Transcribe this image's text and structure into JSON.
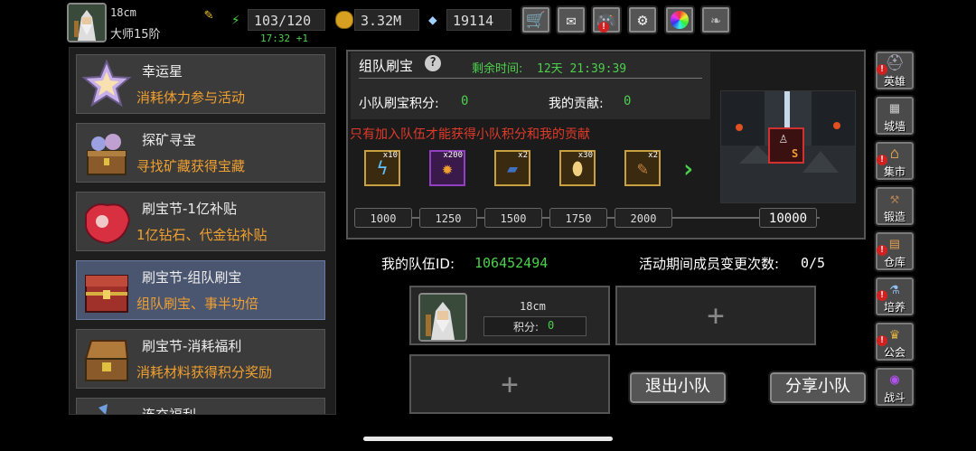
{
  "player": {
    "name": "18cm",
    "rank": "大师15阶",
    "energy": "103/120",
    "energy_timer": "17:32 +1",
    "gold": "3.32M",
    "gems": "19114"
  },
  "top_icons": [
    "shop-icon",
    "mail-icon",
    "gamepad-icon",
    "settings-icon",
    "color-wheel-icon",
    "feather-icon"
  ],
  "sidebar": {
    "items": [
      {
        "title": "幸运星",
        "desc": "消耗体力参与活动",
        "icon": "lucky-star-icon"
      },
      {
        "title": "探矿寻宝",
        "desc": "寻找矿藏获得宝藏",
        "icon": "mining-chest-icon"
      },
      {
        "title": "刷宝节-1亿补贴",
        "desc": "1亿钻石、代金钻补贴",
        "icon": "red-gem-icon"
      },
      {
        "title": "刷宝节-组队刷宝",
        "desc": "组队刷宝、事半功倍",
        "icon": "treasure-chest-icon"
      },
      {
        "title": "刷宝节-消耗福利",
        "desc": "消耗材料获得积分奖励",
        "icon": "open-chest-icon"
      },
      {
        "title": "连充福利",
        "desc": "",
        "icon": "recharge-icon"
      }
    ],
    "selected": 3
  },
  "event": {
    "title": "组队刷宝",
    "remaining_label": "剩余时间:",
    "remaining_time": "12天 21:39:39",
    "team_points_label": "小队刷宝积分:",
    "team_points": "0",
    "my_contrib_label": "我的贡献:",
    "my_contrib": "0",
    "warning": "只有加入队伍才能获得小队积分和我的贡献",
    "rewards": [
      {
        "count": "x10",
        "icon": "lightning-scroll-icon"
      },
      {
        "count": "x200",
        "icon": "flame-gem-icon"
      },
      {
        "count": "x2",
        "icon": "blue-book-icon"
      },
      {
        "count": "x30",
        "icon": "egg-icon"
      },
      {
        "count": "x2",
        "icon": "scroll-icon"
      }
    ],
    "milestones": [
      "1000",
      "1250",
      "1500",
      "1750",
      "2000",
      "10000"
    ],
    "rank_badge": "S"
  },
  "team": {
    "id_label": "我的队伍ID:",
    "id": "106452494",
    "changes_label": "活动期间成员变更次数:",
    "changes": "0/5",
    "member_name": "18cm",
    "member_points_label": "积分:",
    "member_points": "0",
    "add_symbol": "+",
    "leave_button": "退出小队",
    "share_button": "分享小队"
  },
  "right_nav": [
    {
      "label": "英雄",
      "icon": "helmet-icon",
      "alert": true
    },
    {
      "label": "城墙",
      "icon": "wall-icon",
      "alert": false
    },
    {
      "label": "集市",
      "icon": "market-icon",
      "alert": true
    },
    {
      "label": "锻造",
      "icon": "anvil-icon",
      "alert": false
    },
    {
      "label": "仓库",
      "icon": "warehouse-icon",
      "alert": true
    },
    {
      "label": "培养",
      "icon": "potion-icon",
      "alert": true
    },
    {
      "label": "公会",
      "icon": "guild-icon",
      "alert": true
    },
    {
      "label": "战斗",
      "icon": "portal-icon",
      "alert": false
    }
  ],
  "colors": {
    "accent_green": "#4cd04c",
    "warning_red": "#e03a2a",
    "desc_orange": "#f0a030"
  }
}
